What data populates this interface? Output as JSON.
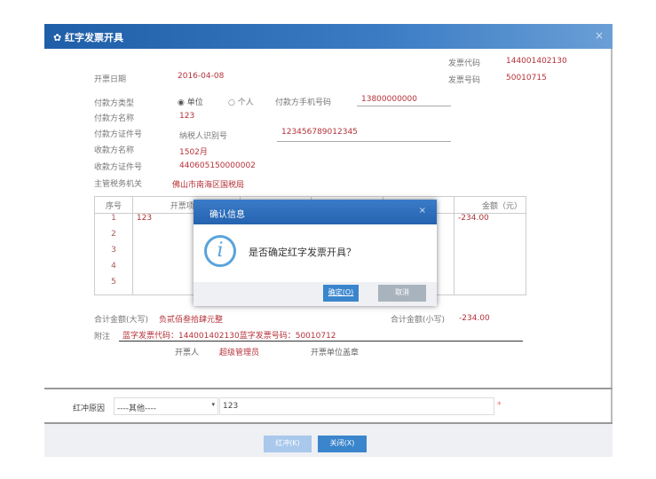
{
  "window": {
    "title": "红字发票开具",
    "close": "×"
  },
  "form": {
    "invoice_code_label": "发票代码",
    "invoice_code": "144001402130",
    "invoice_no_label": "发票号码",
    "invoice_no": "50010715",
    "date_label": "开票日期",
    "date": "2016-04-08",
    "payer_type_label": "付款方类型",
    "payer_type_options": [
      "单位",
      "个人"
    ],
    "payer_phone_label": "付款方手机号码",
    "payer_phone": "13800000000",
    "payer_name_label": "付款方名称",
    "payer_name": "123",
    "payer_id_label": "付款方证件号",
    "payer_id_type": "纳税人识别号",
    "payer_id": "123456789012345",
    "payee_name_label": "收款方名称",
    "payee_name": "1502月",
    "payee_id_label": "收款方证件号",
    "payee_id": "440605150000002",
    "tax_office_label": "主管税务机关",
    "tax_office": "佛山市南海区国税局"
  },
  "table": {
    "headers": [
      "序号",
      "开票项目",
      "",
      "",
      "",
      "金额（元）"
    ],
    "rows": [
      [
        "1",
        "123",
        "-234.00"
      ],
      [
        "2",
        "",
        ""
      ],
      [
        "3",
        "",
        ""
      ],
      [
        "4",
        "",
        ""
      ],
      [
        "5",
        "",
        ""
      ]
    ]
  },
  "totals": {
    "upper_label": "合计金额(大写)",
    "upper": "负贰佰叁拾肆元整",
    "lower_label": "合计金额(小写)",
    "lower": "-234.00"
  },
  "note": {
    "label": "附注",
    "value": "蓝字发票代码：144001402130蓝字发票号码：50010712"
  },
  "issuer": {
    "label": "开票人",
    "value": "超级管理员",
    "stamp": "开票单位盖章"
  },
  "reason": {
    "label": "红冲原因",
    "select": "----其他----",
    "text": "123",
    "required": "*"
  },
  "buttons": {
    "redflush": "红冲(K)",
    "close": "关闭(X)"
  },
  "dialog": {
    "title": "确认信息",
    "close": "×",
    "message": "是否确定红字发票开具？",
    "icon": "i",
    "ok": "确定(O)",
    "cancel": "取消"
  }
}
